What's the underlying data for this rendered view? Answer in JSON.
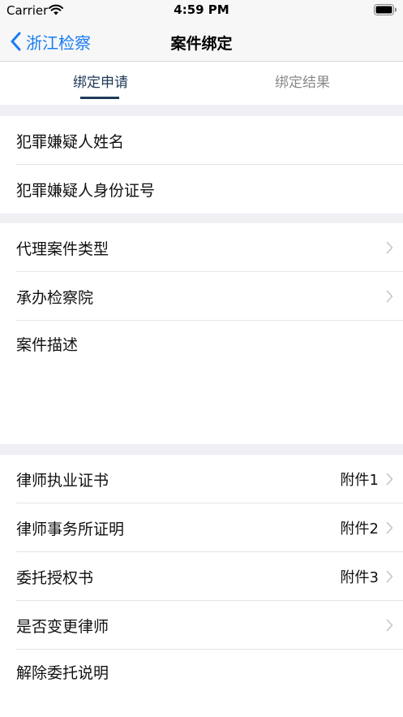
{
  "status": {
    "carrier": "Carrier",
    "time": "4:59 PM"
  },
  "nav": {
    "back_label": "浙江检察",
    "title": "案件绑定"
  },
  "tabs": [
    {
      "label": "绑定申请",
      "active": true
    },
    {
      "label": "绑定结果",
      "active": false
    }
  ],
  "section1": {
    "suspect_name": "犯罪嫌疑人姓名",
    "suspect_id": "犯罪嫌疑人身份证号"
  },
  "section2": {
    "case_type": "代理案件类型",
    "procuratorate": "承办检察院",
    "case_desc": "案件描述"
  },
  "section3": {
    "license_label": "律师执业证书",
    "license_value": "附件1",
    "firm_label": "律师事务所证明",
    "firm_value": "附件2",
    "power_label": "委托授权书",
    "power_value": "附件3",
    "change_lawyer": "是否变更律师",
    "termination": "解除委托说明"
  },
  "colors": {
    "accent": "#1a7cf5",
    "tab_active": "#1f3a57",
    "tab_inactive": "#8a8a8a",
    "background": "#efeff4"
  },
  "icons": {
    "wifi": "wifi-icon",
    "battery": "battery-icon",
    "back": "chevron-left-icon",
    "disclosure": "chevron-right-icon"
  }
}
